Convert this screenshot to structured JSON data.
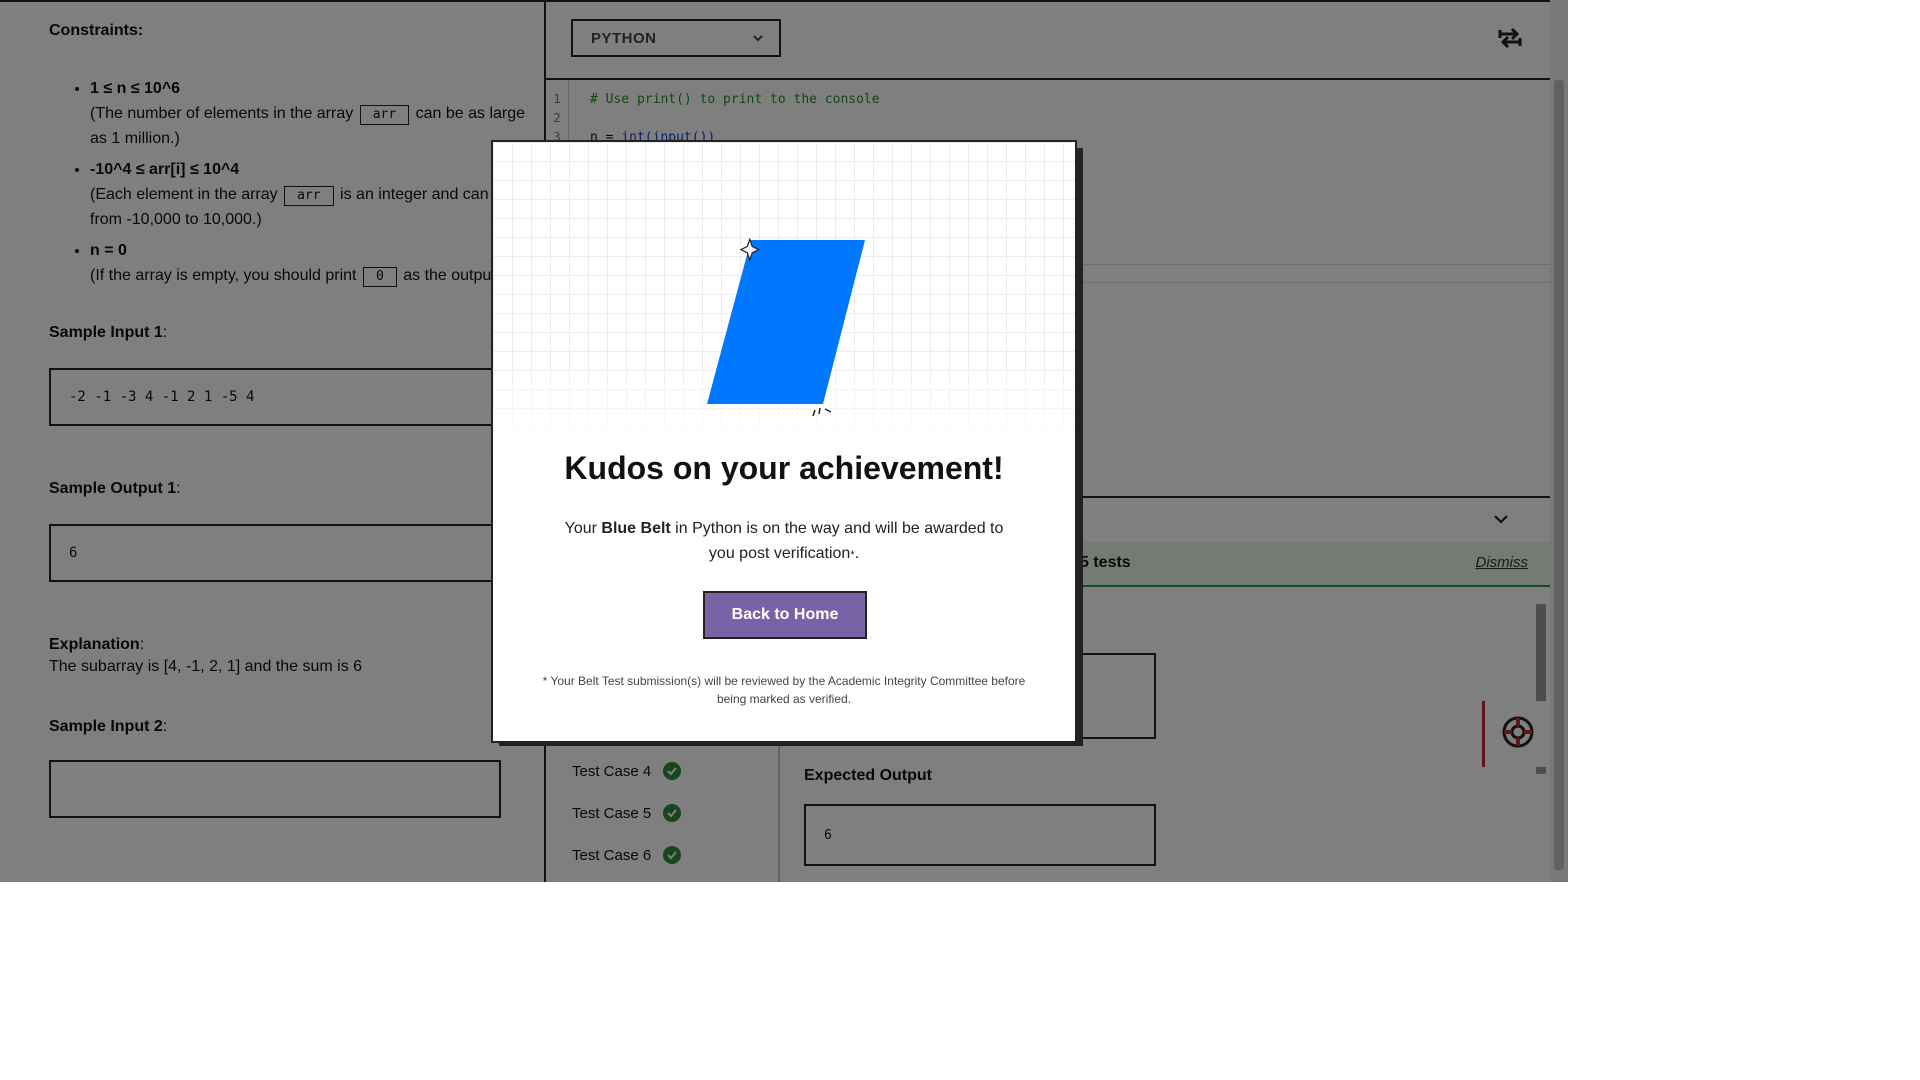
{
  "problem": {
    "constraints_heading": "Constraints:",
    "constraints": [
      {
        "rule": "1 ≤ n ≤ 10^6",
        "desc_before": "(The number of elements in the array",
        "code": "arr",
        "desc_after": "can be as large as 1 million.)"
      },
      {
        "rule": "-10^4 ≤ arr[i] ≤ 10^4",
        "desc_before": "(Each element in the array",
        "code": "arr",
        "desc_after": "is an integer and can range from -10,000 to 10,000.)"
      },
      {
        "rule": "n = 0",
        "desc_before": "(If the array is empty, you should print",
        "code": "0",
        "desc_after": "as the output.)"
      }
    ],
    "sample_input_1_label": "Sample Input 1",
    "sample_input_1": "-2 -1 -3 4 -1 2 1 -5 4",
    "sample_output_1_label": "Sample Output 1",
    "sample_output_1": "6",
    "explanation_label": "Explanation",
    "explanation": "The subarray is [4, -1, 2, 1] and the sum is 6",
    "sample_input_2_label": "Sample Input 2",
    "colon": ":"
  },
  "editor": {
    "language": "PYTHON",
    "line_numbers": [
      "1",
      "2",
      "3"
    ],
    "line1": "# Use print() to print to the console",
    "line3_prefix": "n = ",
    "line3_fn": "int(input())"
  },
  "results": {
    "summary": "5 tests",
    "dismiss": "Dismiss",
    "test_cases": [
      "Test Case 4",
      "Test Case 5",
      "Test Case 6"
    ],
    "expected_output_label": "Expected Output",
    "expected_output": "6"
  },
  "modal": {
    "title": "Kudos on your achievement!",
    "body_prefix": "Your ",
    "belt_name": "Blue Belt",
    "body_middle": " in Python is on the way and will be awarded to you post verification",
    "asterisk": "*",
    "body_end": ".",
    "button": "Back to Home",
    "footnote": "* Your Belt Test submission(s) will be reviewed by the Academic Integrity Committee before being marked as verified.",
    "belt_color": "#0077ff",
    "button_color": "#7a63a5"
  },
  "icons": {
    "swap": "swap-arrows-icon",
    "help": "lifebuoy-icon",
    "sparkle": "sparkle-icon"
  }
}
